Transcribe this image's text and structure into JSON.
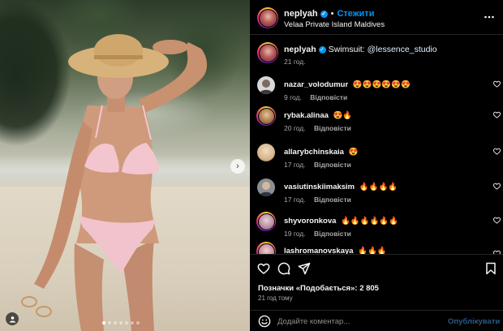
{
  "post": {
    "username": "neplyah",
    "separator": "•",
    "follow_label": "Стежити",
    "location": "Velaa Private Island Maldives",
    "more_icon": "more-horizontal-icon"
  },
  "caption": {
    "username": "neplyah",
    "text": "Swimsuit:",
    "mention": "@lessence_studio",
    "time": "21 год."
  },
  "reply_label": "Відповісти",
  "comments": [
    {
      "username": "nazar_volodumur",
      "text": "😍😍😍😍😍😍",
      "time": "9 год.",
      "avatar_color": "#d8d8d8"
    },
    {
      "username": "rybak.alinaa",
      "text": "😍🔥",
      "time": "20 год.",
      "avatar_color": "#c49a6c"
    },
    {
      "username": "allarybchinskaia",
      "text": "😍",
      "time": "17 год.",
      "avatar_color": "#e2c9a8"
    },
    {
      "username": "vasiutinskiimaksim",
      "text": "🔥🔥🔥🔥",
      "time": "17 год.",
      "avatar_color": "#8a8f96"
    },
    {
      "username": "shyvoronkova",
      "text": "🔥🔥🔥🔥🔥🔥",
      "time": "19 год.",
      "avatar_color": "#b48ca0"
    },
    {
      "username": "lashromanovskaya",
      "text": "🔥🔥🔥",
      "time": "",
      "avatar_color": "#c08a9a"
    }
  ],
  "actions": {
    "likes_text": "Позначки «Подобається»: 2 805",
    "ago": "21 год тому"
  },
  "add_comment": {
    "placeholder": "Додайте коментар...",
    "publish_label": "Опублікувати"
  },
  "photo": {
    "slide_count": 7,
    "active_slide": 1,
    "next_icon": "chevron-right-icon",
    "tag_icon": "user-tag-icon"
  },
  "colors": {
    "accent": "#0095f6",
    "muted": "#a8a8a8",
    "background": "#000000"
  }
}
